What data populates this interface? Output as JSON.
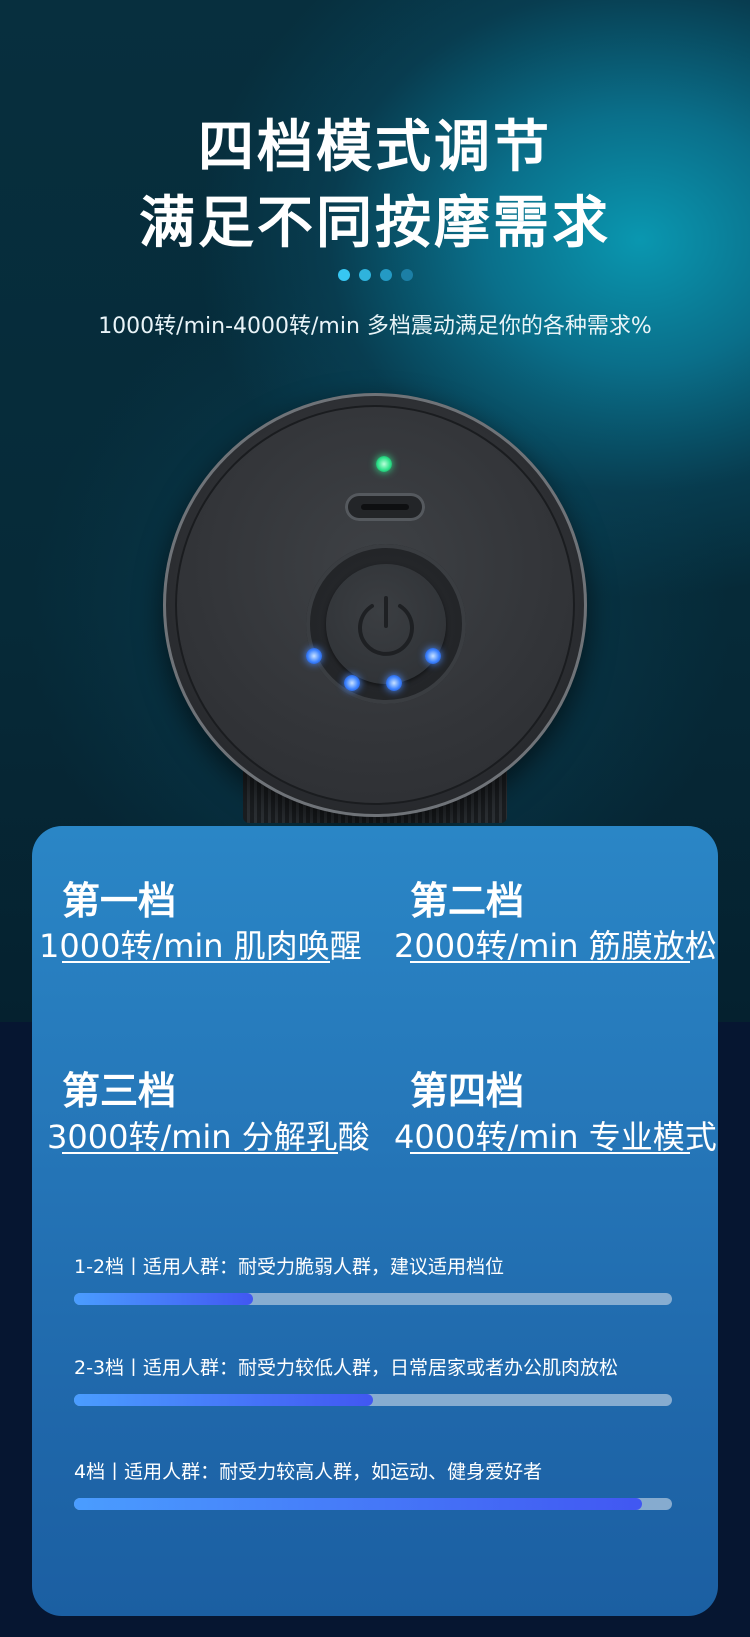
{
  "hero": {
    "title_line1": "四档模式调节",
    "title_line2": "满足不同按摩需求",
    "subtitle": "1000转/min-4000转/min 多档震动满足你的各种需求%",
    "dot_colors": [
      "#37c7f3",
      "#2fb3dd",
      "#249ac4",
      "#1c7fa6"
    ]
  },
  "device": {
    "status_led_color": "#2fe38b",
    "level_led_color": "#3b82ff",
    "level_led_count": 4
  },
  "gears": [
    {
      "name": "第一档",
      "desc": "1000转/min 肌肉唤醒"
    },
    {
      "name": "第二档",
      "desc": "2000转/min 筋膜放松"
    },
    {
      "name": "第三档",
      "desc": "3000转/min 分解乳酸"
    },
    {
      "name": "第四档",
      "desc": "4000转/min 专业模式"
    }
  ],
  "crowds": [
    {
      "label": "1-2档丨适用人群：耐受力脆弱人群，建议适用档位",
      "level": 0.3
    },
    {
      "label": "2-3档丨适用人群：耐受力较低人群，日常居家或者办公肌肉放松",
      "level": 0.5
    },
    {
      "label": "4档丨适用人群：耐受力较高人群，如运动、健身爱好者",
      "level": 0.95
    }
  ],
  "colors": {
    "panel_top": "#2a86c6",
    "panel_bottom": "#1b5fa2",
    "bar_start": "#4a9dff",
    "bar_end": "#4157f2",
    "page_bottom": "#061631"
  }
}
